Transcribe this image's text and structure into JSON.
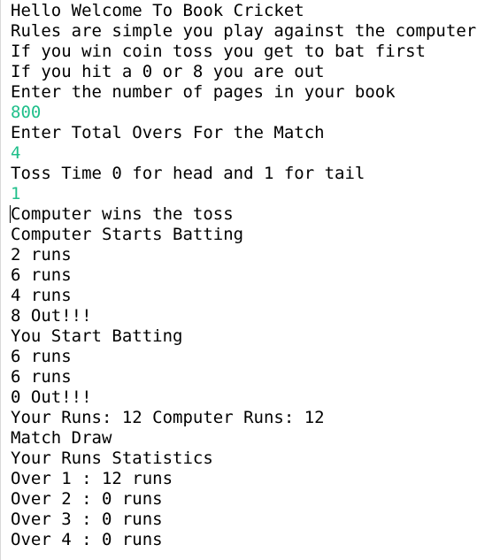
{
  "console": {
    "lines": [
      {
        "text": "Hello Welcome To Book Cricket",
        "kind": "output"
      },
      {
        "text": "Rules are simple you play against the computer",
        "kind": "output"
      },
      {
        "text": "If you win coin toss you get to bat first",
        "kind": "output"
      },
      {
        "text": "If you hit a 0 or 8 you are out",
        "kind": "output"
      },
      {
        "text": "Enter the number of pages in your book",
        "kind": "output"
      },
      {
        "text": "800",
        "kind": "input"
      },
      {
        "text": "Enter Total Overs For the Match",
        "kind": "output"
      },
      {
        "text": "4",
        "kind": "input"
      },
      {
        "text": "Toss Time 0 for head and 1 for tail",
        "kind": "output"
      },
      {
        "text": "1",
        "kind": "input"
      },
      {
        "text": "Computer wins the toss",
        "kind": "output"
      },
      {
        "text": "Computer Starts Batting",
        "kind": "output"
      },
      {
        "text": "2 runs",
        "kind": "output"
      },
      {
        "text": "6 runs",
        "kind": "output"
      },
      {
        "text": "4 runs",
        "kind": "output"
      },
      {
        "text": "8 Out!!!",
        "kind": "output"
      },
      {
        "text": "You Start Batting",
        "kind": "output"
      },
      {
        "text": "6 runs",
        "kind": "output"
      },
      {
        "text": "6 runs",
        "kind": "output"
      },
      {
        "text": "0 Out!!!",
        "kind": "output"
      },
      {
        "text": "Your Runs: 12 Computer Runs: 12",
        "kind": "output"
      },
      {
        "text": "Match Draw",
        "kind": "output"
      },
      {
        "text": "Your Runs Statistics",
        "kind": "output"
      },
      {
        "text": "Over 1 : 12 runs",
        "kind": "output"
      },
      {
        "text": "Over 2 : 0 runs",
        "kind": "output"
      },
      {
        "text": "Over 3 : 0 runs",
        "kind": "output"
      },
      {
        "text": "Over 4 : 0 runs",
        "kind": "output"
      }
    ]
  },
  "colors": {
    "background": "#ffffff",
    "output_text": "#000000",
    "input_text": "#1fbf8a"
  }
}
